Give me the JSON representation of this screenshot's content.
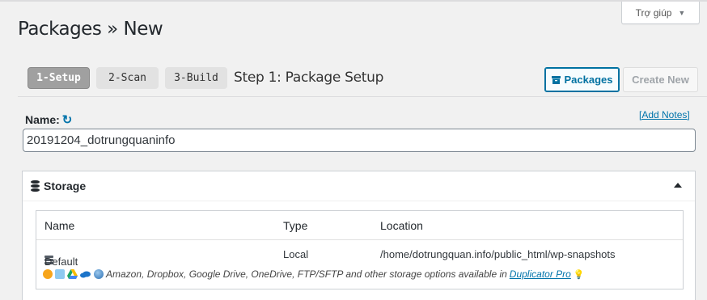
{
  "help": {
    "label": "Trợ giúp"
  },
  "page": {
    "title": "Packages » New"
  },
  "steps": [
    {
      "label": "1-Setup"
    },
    {
      "label": "2-Scan"
    },
    {
      "label": "3-Build"
    }
  ],
  "step_title": "Step 1: Package Setup",
  "toolbar": {
    "packages_label": "Packages",
    "create_new_label": "Create New"
  },
  "name_section": {
    "label": "Name:",
    "add_notes": "[Add Notes]",
    "value": "20191204_dotrungquaninfo"
  },
  "storage": {
    "title": "Storage",
    "columns": [
      "Name",
      "Type",
      "Location"
    ],
    "rows": [
      {
        "name": "Default",
        "type": "Local",
        "location": "/home/dotrungquan.info/public_html/wp-snapshots"
      }
    ],
    "providers_text": "Amazon, Dropbox, Google Drive, OneDrive, FTP/SFTP and other storage options available in",
    "pro_link": "Duplicator Pro"
  },
  "colors": {
    "accent": "#0073aa",
    "active_step": "#a0a0a0"
  }
}
